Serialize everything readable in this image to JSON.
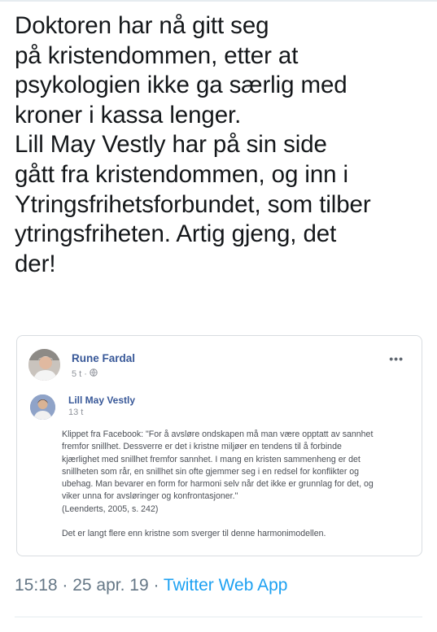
{
  "tweet": {
    "lines": [
      "Doktoren har nå gitt seg",
      "på kristendommen, etter at",
      "psykologien ikke ga særlig med",
      "kroner i kassa lenger.",
      "Lill May Vestly har på sin side",
      "gått fra kristendommen, og inn i",
      "Ytringsfrihetsforbundet, som tilber",
      "ytringsfriheten. Artig gjeng, det",
      "der!"
    ]
  },
  "facebook_post": {
    "author": "Rune Fardal",
    "time": "5 t ·",
    "privacy_icon": "globe-icon",
    "more_icon": "more-options-icon",
    "shared": {
      "author": "Lill May Vestly",
      "time": "13 t",
      "body_lines": [
        "Klippet fra Facebook: \"For å avsløre ondskapen må man være opptatt av sannhet",
        "fremfor snillhet. Dessverre er det i kristne miljøer en tendens til å forbinde",
        "kjærlighet med snillhet fremfor sannhet. I mang en kristen sammenheng er det",
        "snillheten som rår, en snillhet sin ofte gjemmer seg i en redsel for konflikter og",
        "ubehag. Man bevarer en form for harmoni selv når det ikke er grunnlag for det, og",
        "viker unna for avsløringer og konfrontasjoner.\"",
        "(Leenderts, 2005, s. 242)"
      ],
      "follow_up": "Det er langt flere enn kristne som sverger til denne harmonimodellen."
    }
  },
  "meta": {
    "timestamp": "15:18 · 25 apr. 19 · ",
    "source": "Twitter Web App"
  },
  "colors": {
    "text": "#14171a",
    "meta_gray": "#657786",
    "link_blue": "#1da1f2",
    "fb_name_blue": "#385898"
  }
}
